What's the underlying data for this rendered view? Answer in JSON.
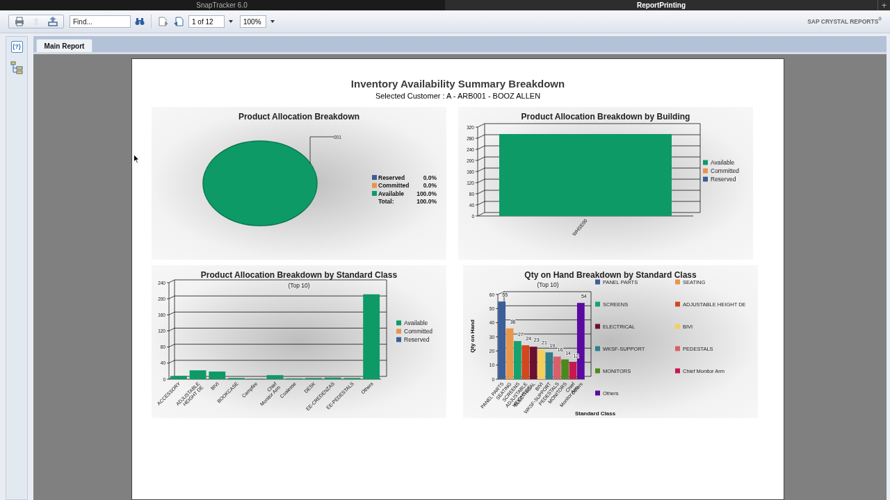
{
  "window_tabs": [
    {
      "label": "SnapTracker 6.0",
      "selected": false
    },
    {
      "label": "ReportPrinting",
      "selected": true
    }
  ],
  "new_tab_button": "+",
  "toolbar": {
    "buttons": [
      {
        "kind": "print",
        "disabled": false
      },
      {
        "kind": "up",
        "disabled": true
      },
      {
        "kind": "export",
        "disabled": false
      }
    ],
    "find": {
      "placeholder": "Find..."
    },
    "page": {
      "value": "1 of 12"
    },
    "zoom": {
      "value": "100%"
    },
    "brand": "SAP CRYSTAL REPORTS$^{®}$"
  },
  "sidebar": {
    "help": "(?)"
  },
  "report_tabs": [
    {
      "label": "Main Report",
      "selected": true
    }
  ],
  "report": {
    "title": "Inventory Availability Summary Breakdown",
    "subtitle": "Selected Customer : A - ARB001 - BOOZ ALLEN",
    "charts": [
      {
        "callout": "001",
        "legend_values": [
          {
            "value": "0.0%",
            "color": "#3a5e97"
          },
          {
            "value": "0.0%",
            "color": "#e9934b"
          },
          {
            "value": "100.0%",
            "color": "#0d9a66"
          }
        ],
        "total": {
          "label": "Total:",
          "value": "100.0%"
        },
        "chart_data": {
          "type": "pie",
          "title": "Product Allocation Breakdown",
          "categories": [
            "Reserved",
            "Committed",
            "Available"
          ],
          "values": [
            0,
            0,
            100
          ],
          "legend": "right"
        }
      },
      {
        "chart_data": {
          "type": "bar",
          "title": "Product Allocation Breakdown by Building",
          "categories": [
            "WHSE00"
          ],
          "stacked": true,
          "legend": "right",
          "series": [
            {
              "name": "Available",
              "color": "#0d9a66",
              "values": [
                295
              ]
            },
            {
              "name": "Committed",
              "color": "#e9934b",
              "values": [
                0
              ]
            },
            {
              "name": "Reserved",
              "color": "#3a5e97",
              "values": [
                0
              ]
            }
          ],
          "ylim": [
            0,
            320
          ],
          "yticks": [
            0,
            40,
            80,
            120,
            160,
            200,
            240,
            280,
            320
          ]
        }
      },
      {
        "subtitle": "(Top 10)",
        "chart_data": {
          "type": "bar",
          "title": "Product Allocation Breakdown by Standard Class",
          "stacked": true,
          "legend": "right",
          "categories": [
            "ACCESSORY",
            "ADJUSTABLE HEIGHT DE",
            "BIVI",
            "BOOKCASE",
            "Campfire",
            "Chief Monitor Arm",
            "Coalesse",
            "DESK",
            "EE-CREDENZAS",
            "EE-PEDESTALS",
            "Others"
          ],
          "series": [
            {
              "name": "Available",
              "color": "#0d9a66",
              "values": [
                8,
                22,
                19,
                3,
                1,
                10,
                2,
                3,
                4,
                3,
                211
              ]
            },
            {
              "name": "Committed",
              "color": "#e9934b",
              "values": [
                0,
                0,
                0,
                0,
                0,
                0,
                0,
                0,
                0,
                0,
                0
              ]
            },
            {
              "name": "Reserved",
              "color": "#3a5e97",
              "values": [
                0,
                0,
                0,
                0,
                0,
                0,
                0,
                0,
                0,
                0,
                0
              ]
            }
          ],
          "ylim": [
            0,
            240
          ],
          "yticks": [
            0,
            40,
            80,
            120,
            160,
            200,
            240
          ]
        }
      },
      {
        "subtitle": "(Top 10)",
        "chart_data": {
          "type": "bar",
          "title": "Qty on Hand Breakdown by Standard Class",
          "stacked": true,
          "data_labels": true,
          "xlabel": "Standard Class",
          "ylabel": "Qty on Hand",
          "legend": "right",
          "categories": [
            "PANEL PARTS",
            "SEATING",
            "SCREENS",
            "ADJUSTABLE HEIGHT DE",
            "ELECTRICAL",
            "BIVI",
            "WKSF-SUPPORT",
            "PEDESTALS",
            "MONITORS",
            "Chief Monitor Arm",
            "Others"
          ],
          "series": [
            {
              "name": "PANEL PARTS",
              "color": "#3b5f99",
              "values": [
                55,
                null,
                null,
                null,
                null,
                null,
                null,
                null,
                null,
                null,
                null
              ]
            },
            {
              "name": "SEATING",
              "color": "#e8964b",
              "values": [
                null,
                36,
                null,
                null,
                null,
                null,
                null,
                null,
                null,
                null,
                null
              ]
            },
            {
              "name": "SCREENS",
              "color": "#14a36e",
              "values": [
                null,
                null,
                27,
                null,
                null,
                null,
                null,
                null,
                null,
                null,
                null
              ]
            },
            {
              "name": "ADJUSTABLE HEIGHT DE",
              "color": "#d3461e",
              "values": [
                null,
                null,
                null,
                24,
                null,
                null,
                null,
                null,
                null,
                null,
                null
              ]
            },
            {
              "name": "ELECTRICAL",
              "color": "#6b1030",
              "values": [
                null,
                null,
                null,
                null,
                23,
                null,
                null,
                null,
                null,
                null,
                null
              ]
            },
            {
              "name": "BIVI",
              "color": "#f4cf5a",
              "values": [
                null,
                null,
                null,
                null,
                null,
                21,
                null,
                null,
                null,
                null,
                null
              ]
            },
            {
              "name": "WKSF-SUPPORT",
              "color": "#2b7f8d",
              "values": [
                null,
                null,
                null,
                null,
                null,
                null,
                19,
                null,
                null,
                null,
                null
              ]
            },
            {
              "name": "PEDESTALS",
              "color": "#d9606a",
              "values": [
                null,
                null,
                null,
                null,
                null,
                null,
                null,
                16,
                null,
                null,
                null
              ]
            },
            {
              "name": "MONITORS",
              "color": "#4a8a1c",
              "values": [
                null,
                null,
                null,
                null,
                null,
                null,
                null,
                null,
                14,
                null,
                null
              ]
            },
            {
              "name": "Chief Monitor Arm",
              "color": "#c8184e",
              "values": [
                null,
                null,
                null,
                null,
                null,
                null,
                null,
                null,
                null,
                12,
                null
              ]
            },
            {
              "name": "Others",
              "color": "#5a0aa0",
              "values": [
                null,
                null,
                null,
                null,
                null,
                null,
                null,
                null,
                null,
                null,
                54
              ]
            }
          ],
          "ylim": [
            0,
            60
          ],
          "yticks": [
            0,
            10,
            20,
            30,
            40,
            50,
            60
          ]
        }
      }
    ]
  }
}
